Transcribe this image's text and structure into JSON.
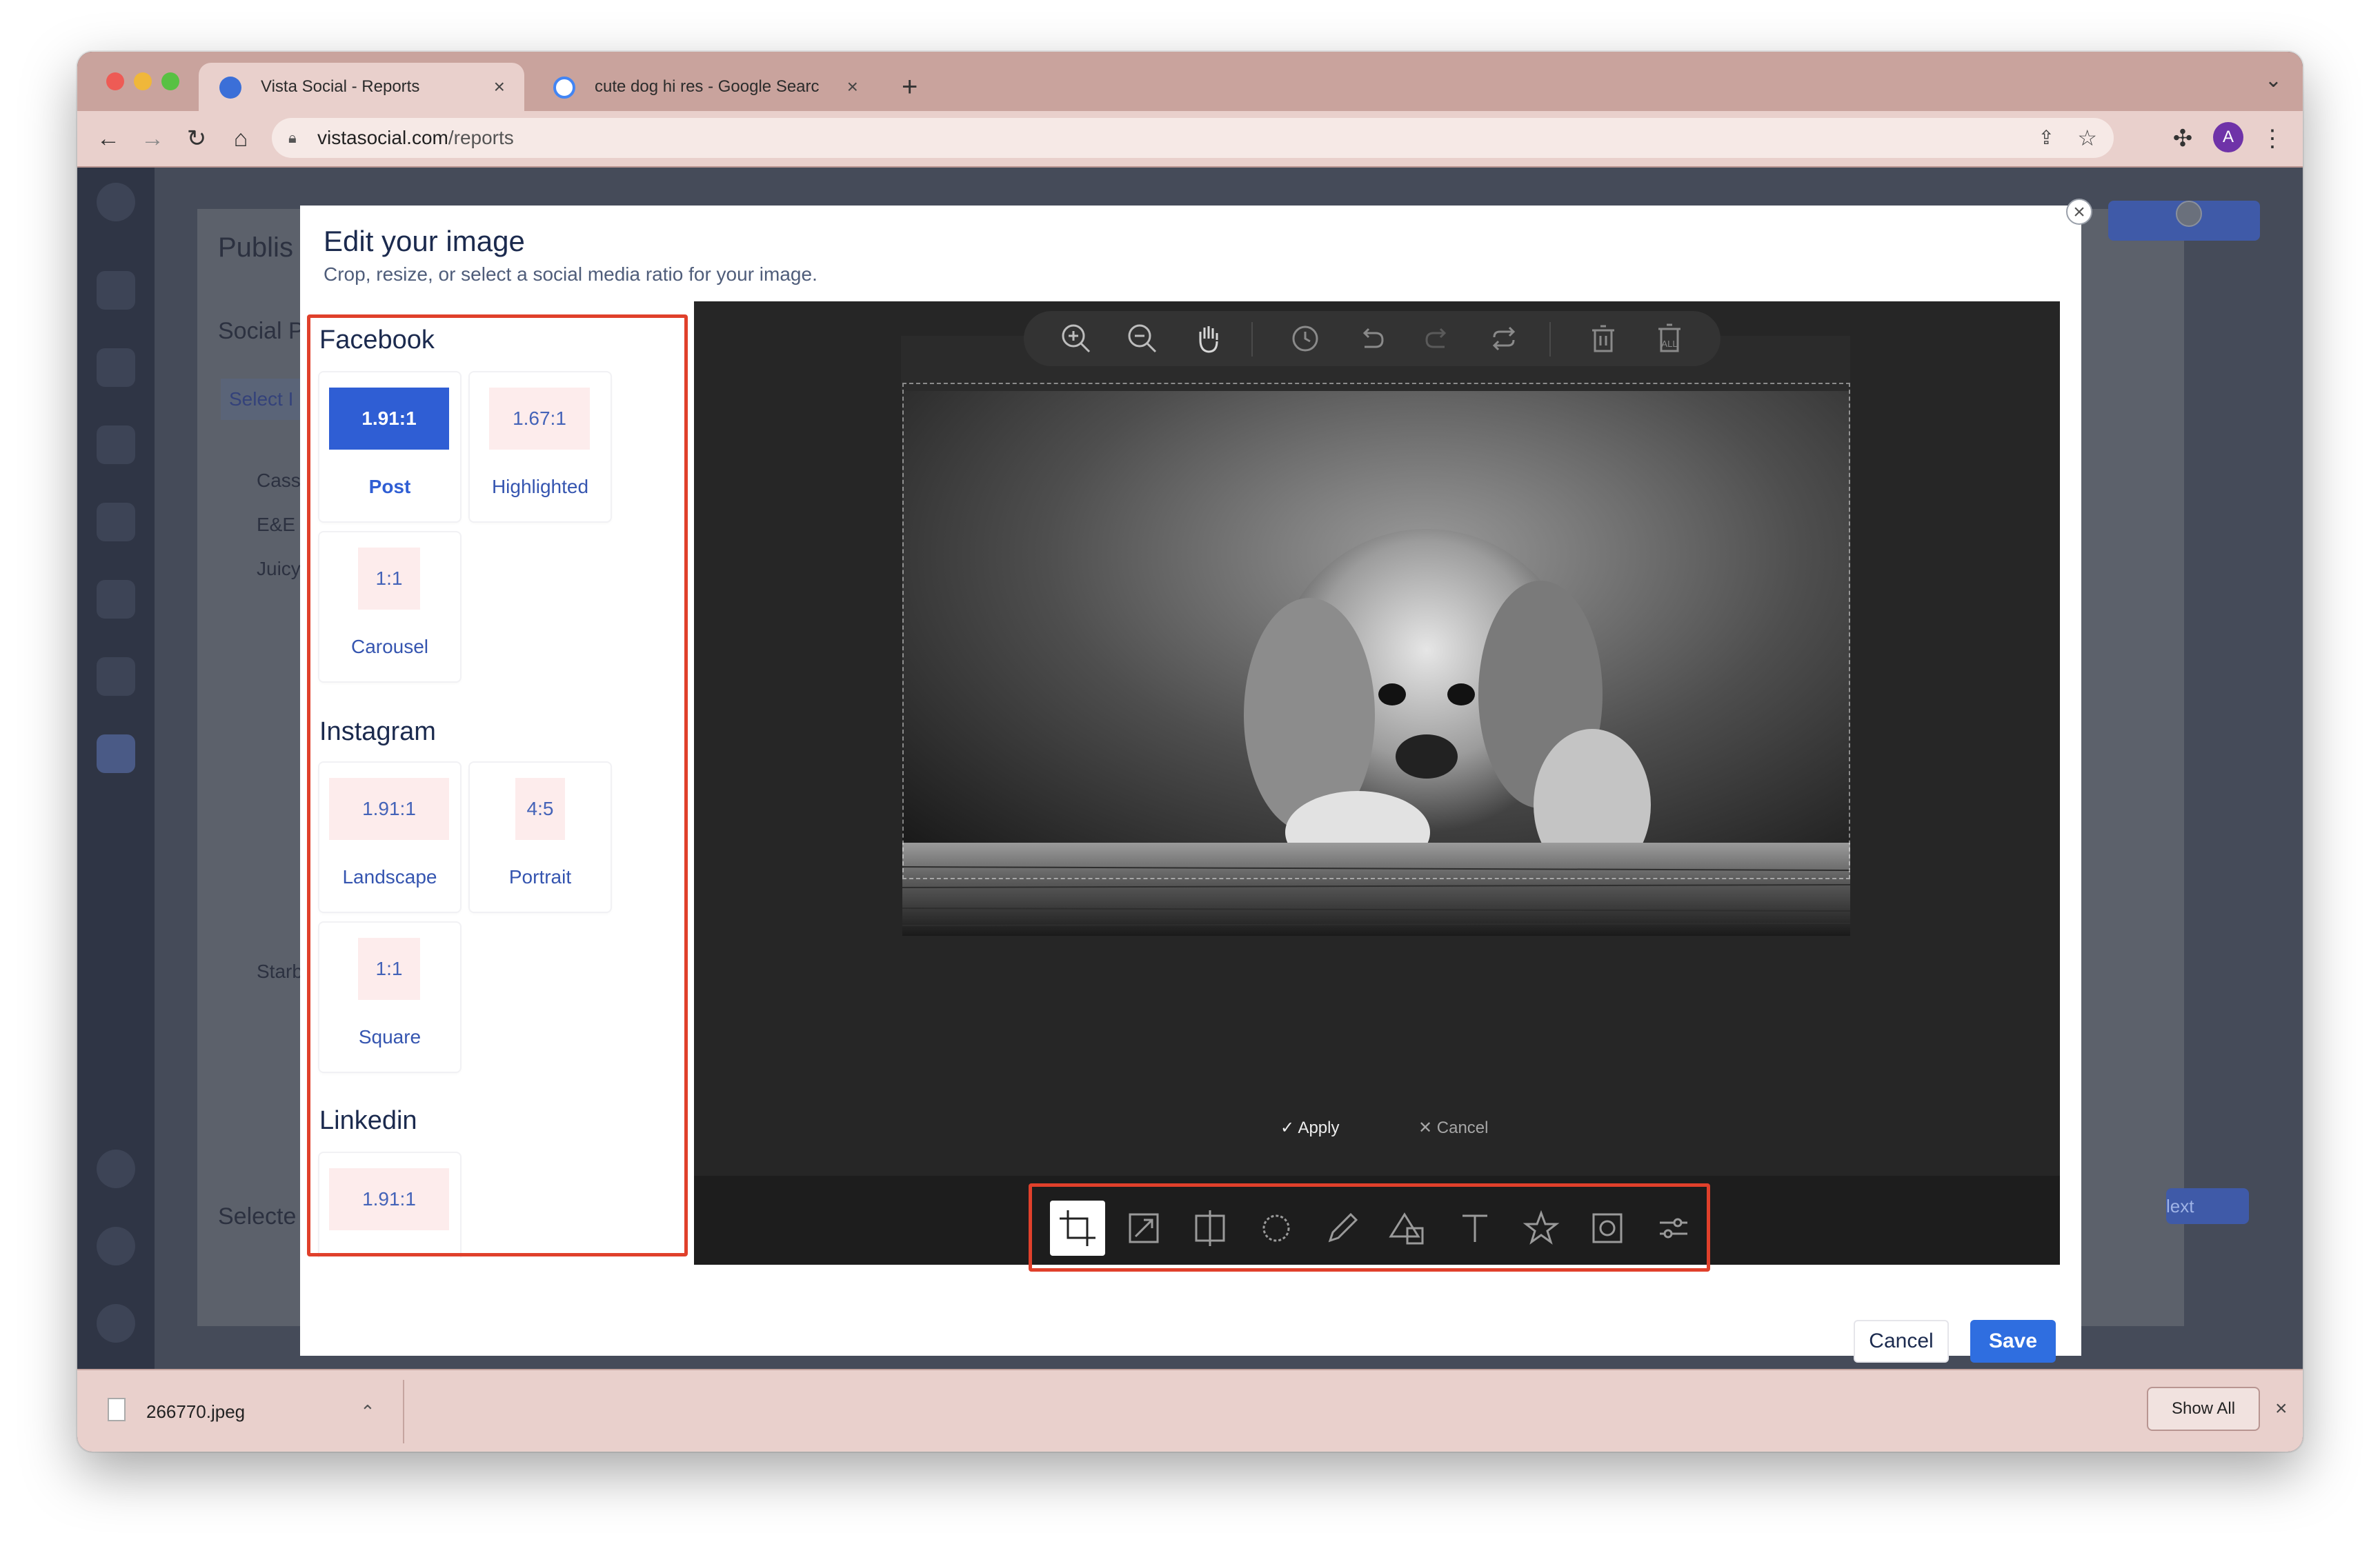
{
  "browser": {
    "tabs": [
      {
        "title": "Vista Social - Reports",
        "active": true
      },
      {
        "title": "cute dog hi res - Google Searc",
        "active": false
      }
    ],
    "url_host": "vistasocial.com",
    "url_path": "/reports",
    "profile_initial": "A"
  },
  "background": {
    "heading": "Publis",
    "section": "Social P",
    "select": "Select I",
    "rows": [
      "Cass",
      "E&E C",
      "Juicy",
      "Starb"
    ],
    "footer": "Selecte",
    "next_label": "lext"
  },
  "modal": {
    "title": "Edit your image",
    "subtitle": "Crop, resize, or select a social media ratio for your image.",
    "groups": [
      {
        "name": "Facebook",
        "options": [
          {
            "ratio": "1.91:1",
            "label": "Post",
            "selected": true
          },
          {
            "ratio": "1.67:1",
            "label": "Highlighted"
          },
          {
            "ratio": "1:1",
            "label": "Carousel"
          }
        ]
      },
      {
        "name": "Instagram",
        "options": [
          {
            "ratio": "1.91:1",
            "label": "Landscape"
          },
          {
            "ratio": "4:5",
            "label": "Portrait"
          },
          {
            "ratio": "1:1",
            "label": "Square"
          }
        ]
      },
      {
        "name": "Linkedin",
        "options": [
          {
            "ratio": "1.91:1",
            "label": ""
          }
        ]
      }
    ],
    "top_tools": [
      "zoom-in-icon",
      "zoom-out-icon",
      "pan-hand-icon",
      "history-icon",
      "undo-icon",
      "redo-icon",
      "reset-icon",
      "delete-icon",
      "delete-all-icon"
    ],
    "delete_all_text": "ALL",
    "apply_label": "Apply",
    "cancel_crop_label": "Cancel",
    "bottom_tools": [
      "crop-icon",
      "resize-icon",
      "flip-icon",
      "rotate-icon",
      "draw-icon",
      "shape-icon",
      "text-icon",
      "sticker-icon",
      "mask-icon",
      "filter-icon"
    ],
    "cancel_label": "Cancel",
    "save_label": "Save"
  },
  "downloads": {
    "file_name": "266770.jpeg",
    "show_all_label": "Show All"
  },
  "colors": {
    "accent": "#2f6ee0",
    "selected_chip": "#2f5ed4",
    "highlight_frame": "#e0402b",
    "editor_bg": "#262626"
  }
}
